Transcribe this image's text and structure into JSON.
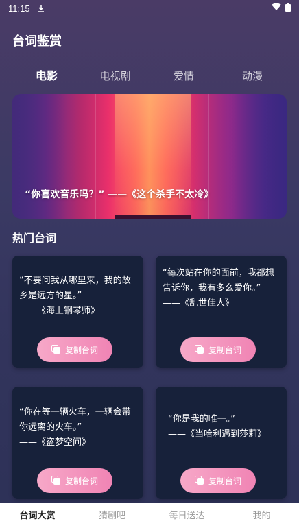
{
  "status": {
    "time": "11:15"
  },
  "header": {
    "title": "台词鉴赏"
  },
  "tabs": [
    {
      "label": "电影",
      "active": true
    },
    {
      "label": "电视剧",
      "active": false
    },
    {
      "label": "爱情",
      "active": false
    },
    {
      "label": "动漫",
      "active": false
    }
  ],
  "banner": {
    "quote": "“你喜欢音乐吗？” ——《这个杀手不太冷》"
  },
  "section": {
    "title": "热门台词"
  },
  "cards": [
    {
      "quote": "“不要问我从哪里来，我的故乡是远方的星。”",
      "source": "——《海上钢琴师》",
      "button": "复制台词"
    },
    {
      "quote": "“每次站在你的面前，我都想告诉你，我有多么爱你。”",
      "source": "——《乱世佳人》",
      "button": "复制台词"
    },
    {
      "quote": "“你在等一辆火车，一辆会带你远离的火车。”",
      "source": "——《盗梦空间》",
      "button": "复制台词"
    },
    {
      "quote": "“你是我的唯一。”",
      "source": "——《当哈利遇到莎莉》",
      "button": "复制台词"
    }
  ],
  "bottom_nav": [
    {
      "label": "台词大赏",
      "active": true
    },
    {
      "label": "猜剧吧",
      "active": false
    },
    {
      "label": "每日送达",
      "active": false
    },
    {
      "label": "我的",
      "active": false
    }
  ],
  "icons": {
    "download": "download-icon",
    "wifi": "wifi-icon",
    "battery": "battery-icon",
    "copy": "copy-icon"
  },
  "colors": {
    "accent_pink": "#f084b4",
    "card_bg": "#17213a",
    "nav_active": "#222222",
    "nav_inactive": "#9a9a9a"
  }
}
